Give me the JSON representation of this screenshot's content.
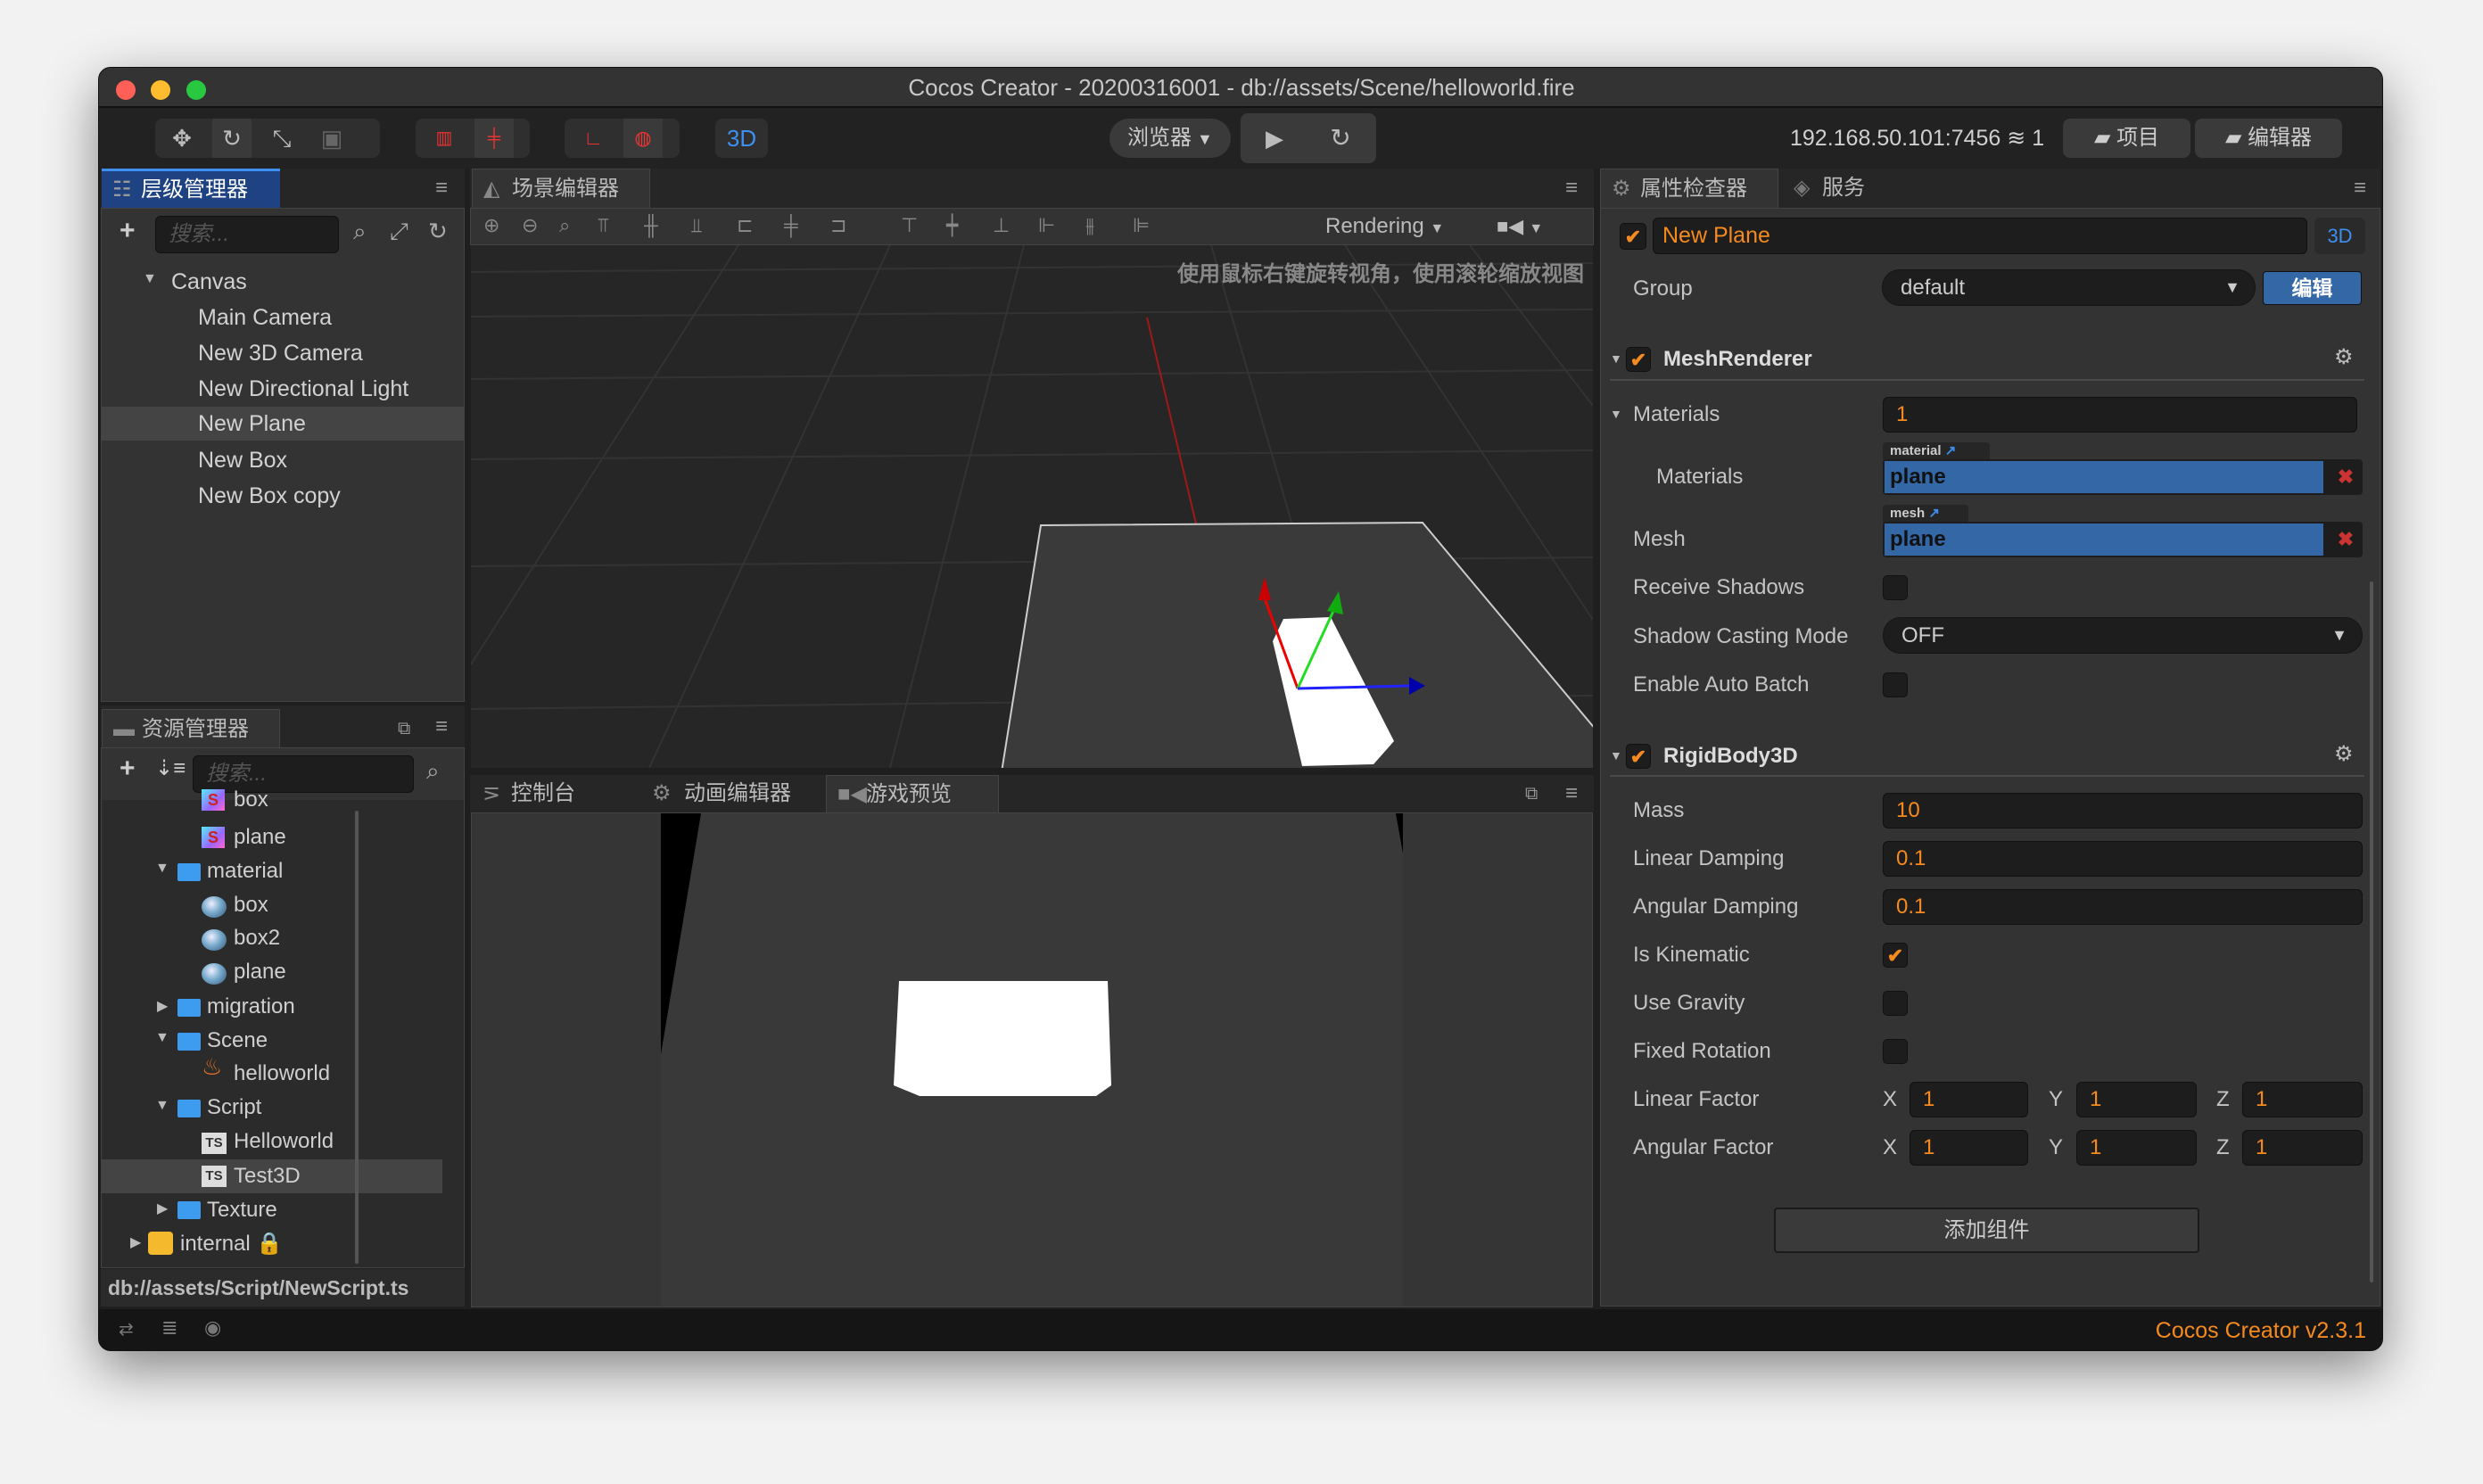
{
  "window": {
    "title": "Cocos Creator - 20200316001 - db://assets/Scene/helloworld.fire"
  },
  "toolbar": {
    "mode_3d": "3D",
    "preview_platform": "浏览器",
    "ip": "192.168.50.101:7456",
    "connections": "1",
    "project_label": "项目",
    "editor_label": "编辑器",
    "accent": "#3f8ff0"
  },
  "hierarchy": {
    "tab": "层级管理器",
    "search_placeholder": "搜索...",
    "root": "Canvas",
    "items": [
      "Main Camera",
      "New 3D Camera",
      "New Directional Light",
      "New Plane",
      "New Box",
      "New Box copy"
    ],
    "selected": "New Plane"
  },
  "assets": {
    "tab": "资源管理器",
    "search_placeholder": "搜索...",
    "rows": [
      {
        "name": "box",
        "icon": "shader-icon"
      },
      {
        "name": "plane",
        "icon": "shader-icon"
      },
      {
        "name": "material",
        "icon": "folder-icon",
        "expanded": true
      },
      {
        "name": "box",
        "icon": "material-sphere-icon"
      },
      {
        "name": "box2",
        "icon": "material-sphere-icon"
      },
      {
        "name": "plane",
        "icon": "material-sphere-icon"
      },
      {
        "name": "migration",
        "icon": "folder-icon",
        "expanded": false
      },
      {
        "name": "Scene",
        "icon": "folder-icon",
        "expanded": true
      },
      {
        "name": "helloworld",
        "icon": "scene-fire-icon"
      },
      {
        "name": "Script",
        "icon": "folder-icon",
        "expanded": true
      },
      {
        "name": "Helloworld",
        "icon": "typescript-icon"
      },
      {
        "name": "Test3D",
        "icon": "typescript-icon"
      },
      {
        "name": "Texture",
        "icon": "folder-icon",
        "expanded": false
      },
      {
        "name": "internal",
        "icon": "internal-db-icon",
        "locked": true
      }
    ],
    "selected": "Test3D",
    "path": "db://assets/Script/NewScript.ts"
  },
  "scene": {
    "tab": "场景编辑器",
    "rendering_label": "Rendering",
    "hint": "使用鼠标右键旋转视角，使用滚轮缩放视图"
  },
  "bottom": {
    "tabs": [
      "控制台",
      "动画编辑器",
      "游戏预览"
    ],
    "active_tab": "游戏预览"
  },
  "inspector": {
    "tabs": [
      "属性检查器",
      "服务"
    ],
    "node_name": "New Plane",
    "node_active": true,
    "badge_3d": "3D",
    "group_label": "Group",
    "group_value": "default",
    "group_edit": "编辑",
    "mesh_renderer": {
      "title": "MeshRenderer",
      "enabled": true,
      "materials_label": "Materials",
      "materials_count": "1",
      "material_item_label": "Materials",
      "material_tag": "material",
      "material_value": "plane",
      "mesh_label": "Mesh",
      "mesh_tag": "mesh",
      "mesh_value": "plane",
      "receive_shadows_label": "Receive Shadows",
      "receive_shadows": false,
      "shadow_mode_label": "Shadow Casting Mode",
      "shadow_mode": "OFF",
      "auto_batch_label": "Enable Auto Batch",
      "auto_batch": false
    },
    "rigidbody": {
      "title": "RigidBody3D",
      "enabled": true,
      "mass_label": "Mass",
      "mass": "10",
      "linear_damping_label": "Linear Damping",
      "linear_damping": "0.1",
      "angular_damping_label": "Angular Damping",
      "angular_damping": "0.1",
      "is_kinematic_label": "Is Kinematic",
      "is_kinematic": true,
      "use_gravity_label": "Use Gravity",
      "use_gravity": false,
      "fixed_rotation_label": "Fixed Rotation",
      "fixed_rotation": false,
      "linear_factor_label": "Linear Factor",
      "linear_factor": {
        "x": "1",
        "y": "1",
        "z": "1"
      },
      "angular_factor_label": "Angular Factor",
      "angular_factor": {
        "x": "1",
        "y": "1",
        "z": "1"
      },
      "axis": {
        "x": "X",
        "y": "Y",
        "z": "Z"
      }
    },
    "add_component": "添加组件"
  },
  "footer": {
    "version": "Cocos Creator v2.3.1",
    "version_color": "#f58a1f"
  }
}
